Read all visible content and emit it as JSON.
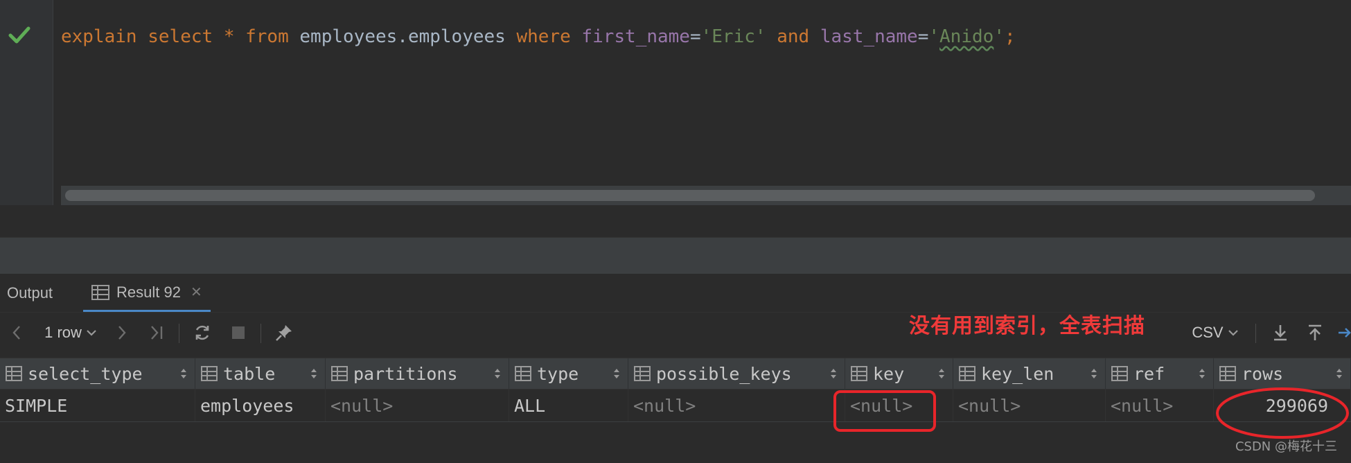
{
  "editor": {
    "status_icon": "check-icon",
    "sql": {
      "t1": "explain",
      "t2": "select",
      "t3": "*",
      "t4": "from",
      "t5": "employees.employees",
      "t6": "where",
      "t7": "first_name",
      "t8": "=",
      "t9": "'Eric'",
      "t10": "and",
      "t11": "last_name",
      "t12": "=",
      "t13": "'",
      "t14": "Anido",
      "t15": "'",
      "t16": ";"
    }
  },
  "tabs": {
    "output": "Output",
    "result": "Result 92",
    "close": "✕"
  },
  "toolbar": {
    "row_count": "1 row",
    "export_format": "CSV"
  },
  "annotation": "没有用到索引，全表扫描",
  "grid": {
    "columns": [
      "select_type",
      "table",
      "partitions",
      "type",
      "possible_keys",
      "key",
      "key_len",
      "ref",
      "rows"
    ],
    "row": [
      "SIMPLE",
      "employees",
      "<null>",
      "ALL",
      "<null>",
      "<null>",
      "<null>",
      "<null>",
      "299069"
    ]
  },
  "watermark": "CSDN @梅花十三",
  "colors": {
    "background": "#2b2b2b",
    "keyword": "#cc7832",
    "string": "#6a8759",
    "column": "#9876aa",
    "annotation_red": "#f03a3a",
    "check_green": "#5fad56"
  }
}
